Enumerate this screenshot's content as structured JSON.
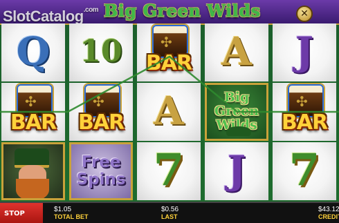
{
  "header": {
    "watermark": "SlotCatalog",
    "watermark_suffix": ".com",
    "game_title": "Big Green Wilds",
    "close_icon": "close-icon"
  },
  "reels": [
    [
      {
        "symbol": "Q",
        "bg": "white"
      },
      {
        "symbol": "BAR",
        "bg": "white"
      },
      {
        "symbol": "leprechaun",
        "bg": "dark"
      }
    ],
    [
      {
        "symbol": "10",
        "bg": "white"
      },
      {
        "symbol": "BAR",
        "bg": "white"
      },
      {
        "symbol": "free-spins",
        "bg": "purple",
        "label": "Free Spins"
      }
    ],
    [
      {
        "symbol": "BAR",
        "bg": "white"
      },
      {
        "symbol": "A",
        "bg": "white"
      },
      {
        "symbol": "7",
        "bg": "white"
      }
    ],
    [
      {
        "symbol": "A",
        "bg": "white"
      },
      {
        "symbol": "wild",
        "bg": "green",
        "label": "Big Green Wilds"
      },
      {
        "symbol": "J",
        "bg": "white"
      }
    ],
    [
      {
        "symbol": "J",
        "bg": "white"
      },
      {
        "symbol": "BAR",
        "bg": "white"
      },
      {
        "symbol": "7",
        "bg": "white"
      }
    ]
  ],
  "bottom": {
    "stop_label": "STOP",
    "total_bet_value": "$1.05",
    "total_bet_label": "TOTAL BET",
    "last_value": "$0.56",
    "last_label": "LAST",
    "credit_value": "$43.12",
    "credit_label": "CREDIT"
  },
  "colors": {
    "accent_gold": "#c9a23a",
    "title_green": "#3fb848",
    "stop_red": "#d42a25",
    "label_yellow": "#ffd23a"
  }
}
